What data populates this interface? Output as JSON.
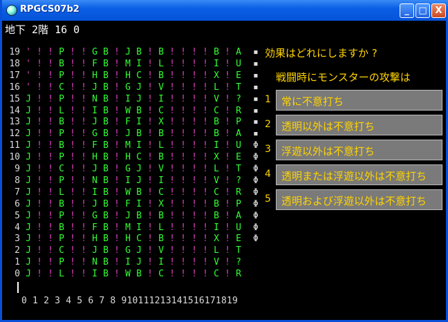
{
  "window": {
    "title": "RPGCS07b2",
    "minimize": "_",
    "maximize": "□",
    "close": "X"
  },
  "floor_status": "地下 2階 16 0",
  "map": {
    "rows": [
      {
        "label": "19",
        "text": " ' ! ! P ! ! G B ! J B ! B ! ! ! ! B ! A"
      },
      {
        "label": "18",
        "text": " ' ! ! B ! ! F B ! M I ! L ! ! ! ! I ! U"
      },
      {
        "label": "17",
        "text": " ' ! ! P ! ! H B ! H C ! B ! ! ! ! X ! E"
      },
      {
        "label": "16",
        "text": " ' ! ! C ! ! J B ! G J ! V ! ! ! ! L ! T"
      },
      {
        "label": "15",
        "text": " J ! ! P ! ! N B ! I J ! I ! ! ! ! V ! ?"
      },
      {
        "label": "14",
        "text": " J ! ! L ! ! I B ! W B ! C ! ! ! ! C ! R"
      },
      {
        "label": "13",
        "text": " J ! ! B ! ! J B ! F I ! X ! ! ! ! B ! P"
      },
      {
        "label": "12",
        "text": " J ! ! P ! ! G B ! J B ! B ! ! ! ! B ! A"
      },
      {
        "label": "11",
        "text": " J ! ! B ! ! F B ! M I ! L ! ! ! ! I ! U"
      },
      {
        "label": "10",
        "text": " J ! ! P ! ! H B ! H C ! B ! ! ! ! X ! E"
      },
      {
        "label": "9",
        "text": " J ! ! C ! ! J B ! G J ! V ! ! ! ! L ! T"
      },
      {
        "label": "8",
        "text": " J ! ! P ! ! N B ! I J ! I ! ! ! ! V ! ?"
      },
      {
        "label": "7",
        "text": " J ! ! L ! ! I B ! W B ! C ! ! ! ! C ! R"
      },
      {
        "label": "6",
        "text": " J ! ! B ! ! J B ! F I ! X ! ! ! ! B ! P"
      },
      {
        "label": "5",
        "text": " J ! ! P ! ! G B ! J B ! B ! ! ! ! B ! A"
      },
      {
        "label": "4",
        "text": " J ! ! B ! ! F B ! M I ! L ! ! ! ! I ! U"
      },
      {
        "label": "3",
        "text": " J ! ! P ! ! H B ! H C ! B ! ! ! ! X ! E"
      },
      {
        "label": "2",
        "text": " J ! ! C ! ! J B ! G J ! V ! ! ! ! L ! T"
      },
      {
        "label": "1",
        "text": " J ! ! P ! ! N B ! I J ! I ! ! ! ! V ! ?"
      },
      {
        "label": "0",
        "text": " J ! ! L ! ! I B ! W B ! C ! ! ! ! C ! R"
      }
    ],
    "side_marks": [
      "▪",
      "▪",
      "▪",
      "▪",
      "▪",
      "▪",
      "▪",
      "▪",
      "Φ",
      "Φ",
      "Φ",
      "Φ",
      "Φ",
      "Φ",
      "Φ",
      "Φ",
      "Φ"
    ],
    "x_axis": "0 1 2 3 4 5 6 7 8 910111213141516171819"
  },
  "dialog": {
    "question": "効果はどれにしますか ?",
    "subquestion": "戦闘時にモンスターの攻撃は",
    "options": [
      {
        "num": "1",
        "label": "常に不意打ち"
      },
      {
        "num": "2",
        "label": "透明以外は不意打ち"
      },
      {
        "num": "3",
        "label": "浮遊以外は不意打ち"
      },
      {
        "num": "4",
        "label": "透明または浮遊以外は不意打ち"
      },
      {
        "num": "5",
        "label": "透明および浮遊以外は不意打ち"
      }
    ]
  },
  "colors": {
    "map_text": "#33ff33",
    "wall": "#e040c0",
    "dialog_text": "#ffd400",
    "option_bg": "#7a7a7a"
  }
}
